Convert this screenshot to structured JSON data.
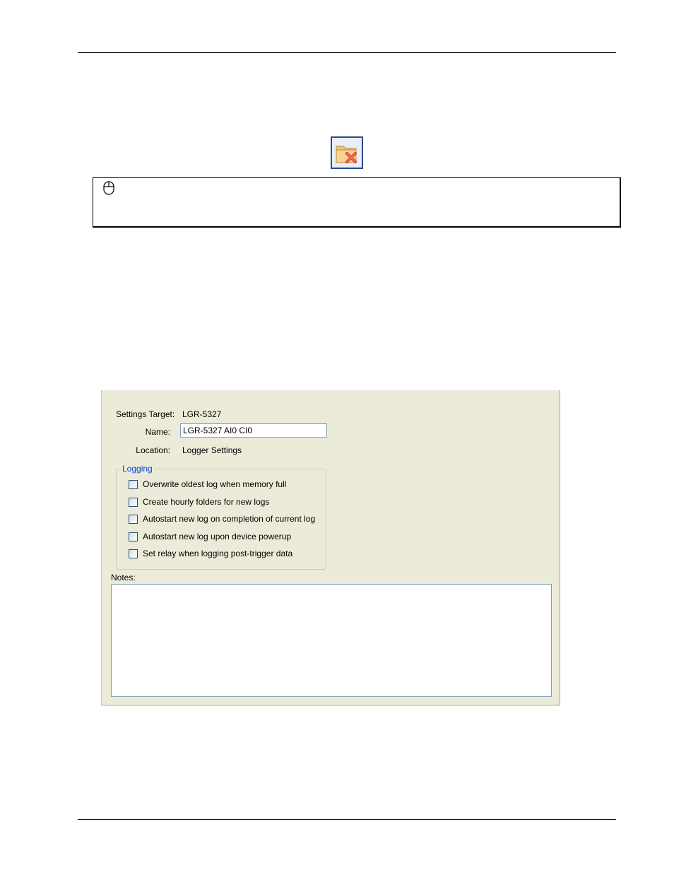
{
  "icons": {
    "toolbar_icon": "folder-delete-icon",
    "note_icon": "mouse-icon"
  },
  "colors": {
    "panel_bg": "#ecead9",
    "group_title": "#0046d5",
    "input_border": "#7f9db9"
  },
  "dialog": {
    "settings_target_label": "Settings Target:",
    "settings_target_value": "LGR-5327",
    "name_label": "Name:",
    "name_value": "LGR-5327 AI0 CI0",
    "location_label": "Location:",
    "location_value": "Logger Settings",
    "logging": {
      "title": "Logging",
      "options": [
        {
          "label": "Overwrite oldest log when memory full",
          "checked": false
        },
        {
          "label": "Create hourly folders for new logs",
          "checked": false
        },
        {
          "label": "Autostart new log on completion of current log",
          "checked": false
        },
        {
          "label": "Autostart new log upon device powerup",
          "checked": false
        },
        {
          "label": "Set relay when logging post-trigger data",
          "checked": false
        }
      ]
    },
    "notes_label": "Notes:",
    "notes_value": ""
  }
}
